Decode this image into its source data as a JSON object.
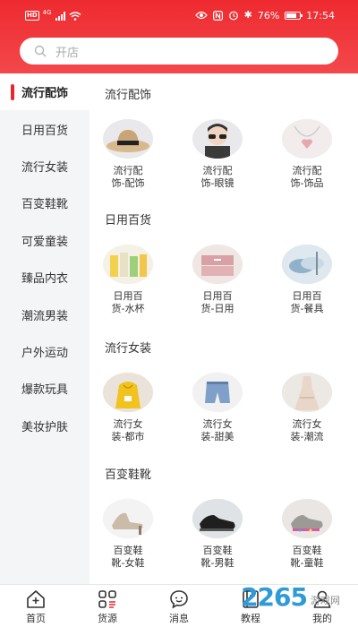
{
  "status_bar": {
    "network_badge": "HD",
    "network_type": "4G",
    "battery": "76%",
    "battery_level": 0.76,
    "time": "17:54"
  },
  "search": {
    "placeholder": "开店"
  },
  "sidebar": {
    "items": [
      {
        "label": "流行配饰",
        "active": true
      },
      {
        "label": "日用百货"
      },
      {
        "label": "流行女装"
      },
      {
        "label": "百变鞋靴"
      },
      {
        "label": "可爱童装"
      },
      {
        "label": "臻品内衣"
      },
      {
        "label": "潮流男装"
      },
      {
        "label": "户外运动"
      },
      {
        "label": "爆款玩具"
      },
      {
        "label": "美妆护肤"
      }
    ]
  },
  "sections": [
    {
      "title": "流行配饰",
      "items": [
        {
          "line1": "流行配",
          "line2": "饰-配饰",
          "icon": "hat-photo"
        },
        {
          "line1": "流行配",
          "line2": "饰-眼镜",
          "icon": "glasses-photo"
        },
        {
          "line1": "流行配",
          "line2": "饰-饰品",
          "icon": "necklace-photo"
        }
      ]
    },
    {
      "title": "日用百货",
      "items": [
        {
          "line1": "日用百",
          "line2": "货-水杯",
          "icon": "cups-photo"
        },
        {
          "line1": "日用百",
          "line2": "货-日用",
          "icon": "storage-box-photo"
        },
        {
          "line1": "日用百",
          "line2": "货-餐具",
          "icon": "tableware-photo"
        }
      ]
    },
    {
      "title": "流行女装",
      "items": [
        {
          "line1": "流行女",
          "line2": "装-都市",
          "icon": "hoodie-photo"
        },
        {
          "line1": "流行女",
          "line2": "装-甜美",
          "icon": "denim-shorts-photo"
        },
        {
          "line1": "流行女",
          "line2": "装-潮流",
          "icon": "dress-photo"
        }
      ]
    },
    {
      "title": "百变鞋靴",
      "items": [
        {
          "line1": "百变鞋",
          "line2": "靴-女鞋",
          "icon": "women-shoe-photo"
        },
        {
          "line1": "百变鞋",
          "line2": "靴-男鞋",
          "icon": "men-shoe-photo"
        },
        {
          "line1": "百变鞋",
          "line2": "靴-童鞋",
          "icon": "kids-shoe-photo"
        }
      ]
    }
  ],
  "tabbar": [
    {
      "label": "首页",
      "icon": "home-icon"
    },
    {
      "label": "货源",
      "icon": "grid-menu-icon"
    },
    {
      "label": "消息",
      "icon": "chat-face-icon"
    },
    {
      "label": "教程",
      "icon": "book-icon"
    },
    {
      "label": "我的",
      "icon": "user-icon"
    }
  ],
  "watermark": {
    "logo": "2265",
    "text": "游戏网"
  },
  "colors": {
    "brand_red": "#ee2a2f",
    "sidebar_bg": "#f4f5f7",
    "watermark_blue": "#2f9ad8"
  }
}
